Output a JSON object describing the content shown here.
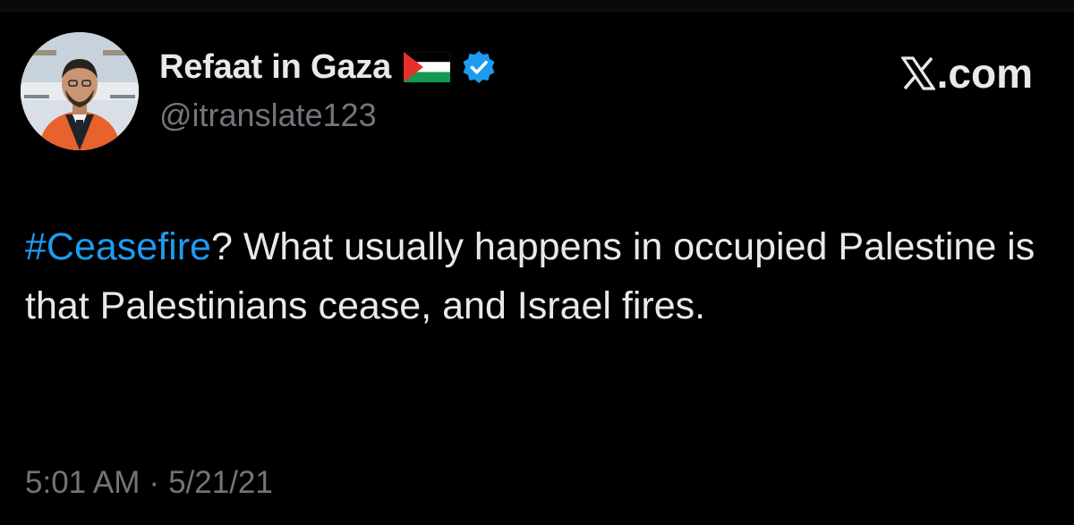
{
  "author": {
    "display_name": "Refaat in Gaza",
    "flag_icon": "palestine-flag-icon",
    "verified_icon": "verified-badge-icon",
    "handle": "@itranslate123"
  },
  "brand": {
    "icon": "x-logo-icon",
    "domain": ".com"
  },
  "tweet": {
    "hashtag": "#Ceasefire",
    "body": "? What usually happens in occupied Palestine is that Palestinians cease, and Israel fires."
  },
  "meta": {
    "time": "5:01 AM",
    "separator": "·",
    "date": "5/21/21"
  },
  "colors": {
    "background": "#000000",
    "text": "#e7e9ea",
    "muted": "#71767b",
    "link": "#1d9bf0",
    "verified": "#1d9bf0"
  }
}
